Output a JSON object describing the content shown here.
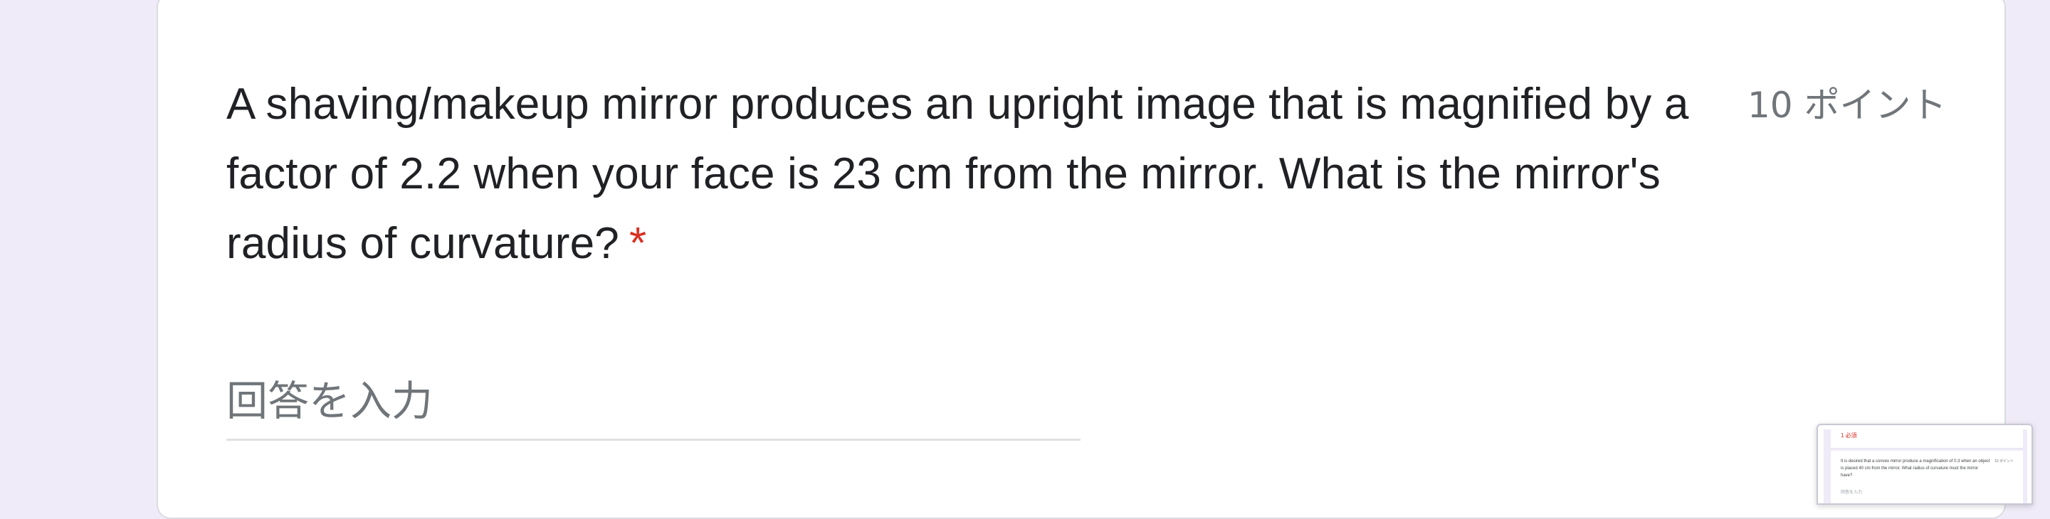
{
  "question": {
    "text": "A shaving/makeup mirror produces an upright image that is magnified by a factor of 2.2 when your face is 23 cm from the mirror. What is the mirror's radius of curvature?",
    "required_marker": "*",
    "points": "10 ポイント"
  },
  "answer": {
    "placeholder": "回答を入力",
    "value": ""
  },
  "thumbnail": {
    "header": "1 必須",
    "question": "It is desired that a convex mirror produce a magnification of 0.3 when an object is placed 40 cm from the mirror. What radius of curvature must the mirror have?",
    "points": "10 ポイント",
    "answer_placeholder": "回答を入力"
  },
  "colors": {
    "background": "#f0ebf8",
    "card": "#ffffff",
    "required": "#d93025",
    "text": "#202124",
    "muted": "#70757a"
  }
}
